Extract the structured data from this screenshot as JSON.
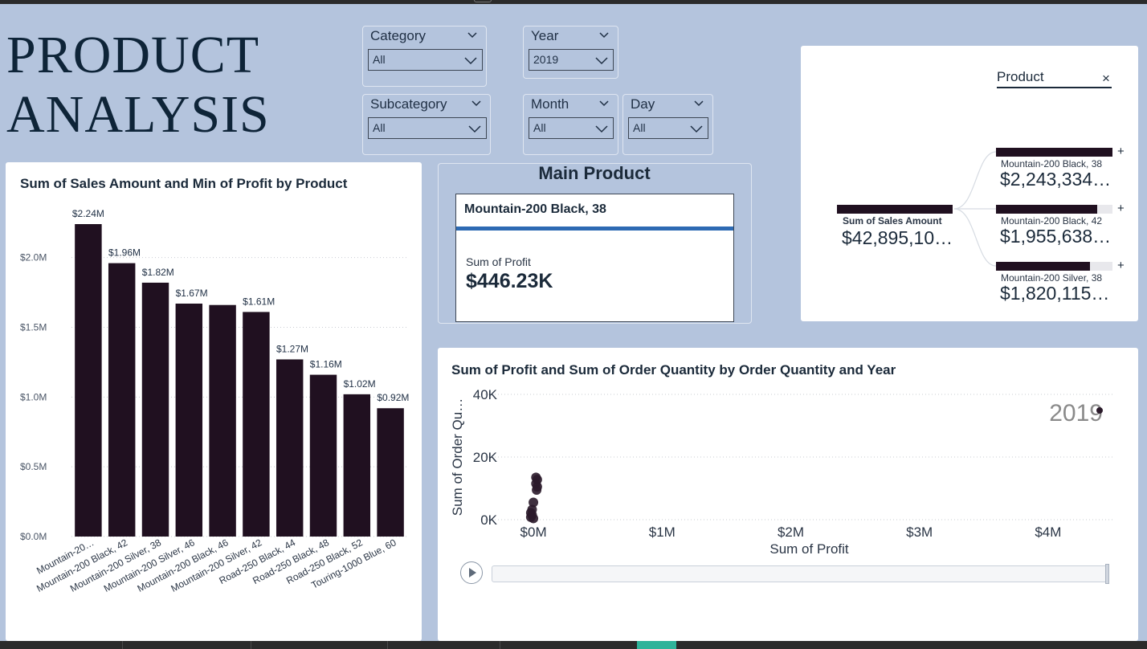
{
  "page": {
    "title_line1": "PRODUCT",
    "title_line2": "ANALYSIS"
  },
  "slicers": {
    "category": {
      "label": "Category",
      "value": "All"
    },
    "year": {
      "label": "Year",
      "value": "2019"
    },
    "subcategory": {
      "label": "Subcategory",
      "value": "All"
    },
    "month": {
      "label": "Month",
      "value": "All"
    },
    "day": {
      "label": "Day",
      "value": "All"
    }
  },
  "colors": {
    "bar": "#201020",
    "background": "#b4c4dd",
    "accent": "#2d6ab3",
    "scatter": "#2a1a2a"
  },
  "main_product": {
    "title": "Main Product",
    "name": "Mountain-200 Black, 38",
    "metric_label": "Sum of Profit",
    "metric_value": "$446.23K"
  },
  "decomposition": {
    "header": "Product",
    "close_icon": "close-icon",
    "root_label": "Sum of Sales Amount",
    "root_value": "$42,895,10…",
    "nodes": [
      {
        "label": "Mountain-200 Black, 38",
        "value": "$2,243,334…",
        "fill": 1.0
      },
      {
        "label": "Mountain-200 Black, 42",
        "value": "$1,955,638…",
        "fill": 0.87
      },
      {
        "label": "Mountain-200 Silver, 38",
        "value": "$1,820,115…",
        "fill": 0.81
      }
    ],
    "expand_symbol": "+"
  },
  "chart_data": [
    {
      "type": "bar",
      "title": "Sum of Sales Amount and Min of Profit by Product",
      "categories": [
        "Mountain-20…",
        "Mountain-200 Black, 42",
        "Mountain-200 Silver, 38",
        "Mountain-200 Silver, 46",
        "Mountain-200 Black, 46",
        "Mountain-200 Silver, 42",
        "Road-250 Black, 44",
        "Road-250 Black, 48",
        "Road-250 Black, 52",
        "Touring-1000 Blue, 60"
      ],
      "values": [
        2.24,
        1.96,
        1.82,
        1.67,
        1.66,
        1.61,
        1.27,
        1.16,
        1.02,
        0.92
      ],
      "data_labels": [
        "$2.24M",
        "$1.96M",
        "$1.82M",
        "$1.67M",
        "",
        "$1.61M",
        "$1.27M",
        "$1.16M",
        "$1.02M",
        "$0.92M"
      ],
      "yticks": [
        "$0.0M",
        "$0.5M",
        "$1.0M",
        "$1.5M",
        "$2.0M"
      ],
      "ytick_values": [
        0,
        0.5,
        1.0,
        1.5,
        2.0
      ],
      "ylim": [
        0,
        2.24
      ],
      "unit": "$M",
      "grid": true
    },
    {
      "type": "scatter",
      "title": "Sum of Profit and Sum of Order Quantity by Order Quantity and Year",
      "xlabel": "Sum of Profit",
      "ylabel": "Sum of Order Qu…",
      "xticks": [
        "$0M",
        "$1M",
        "$2M",
        "$3M",
        "$4M"
      ],
      "xtick_values": [
        0,
        1,
        2,
        3,
        4
      ],
      "yticks": [
        "0K",
        "20K",
        "40K"
      ],
      "ytick_values": [
        0,
        20000,
        40000
      ],
      "xlim": [
        -0.4,
        4.5
      ],
      "ylim": [
        0,
        40000
      ],
      "play_axis_label": "2019",
      "points": [
        {
          "x": 0.02,
          "y": 13500
        },
        {
          "x": 0.03,
          "y": 12800
        },
        {
          "x": 0.02,
          "y": 11500
        },
        {
          "x": 0.03,
          "y": 10500
        },
        {
          "x": 0.025,
          "y": 9500
        },
        {
          "x": 0.0,
          "y": 5500
        },
        {
          "x": -0.01,
          "y": 3200
        },
        {
          "x": -0.02,
          "y": 2200
        },
        {
          "x": -0.01,
          "y": 1500
        },
        {
          "x": -0.02,
          "y": 800
        },
        {
          "x": 0.0,
          "y": 400
        }
      ],
      "grid": true
    }
  ]
}
